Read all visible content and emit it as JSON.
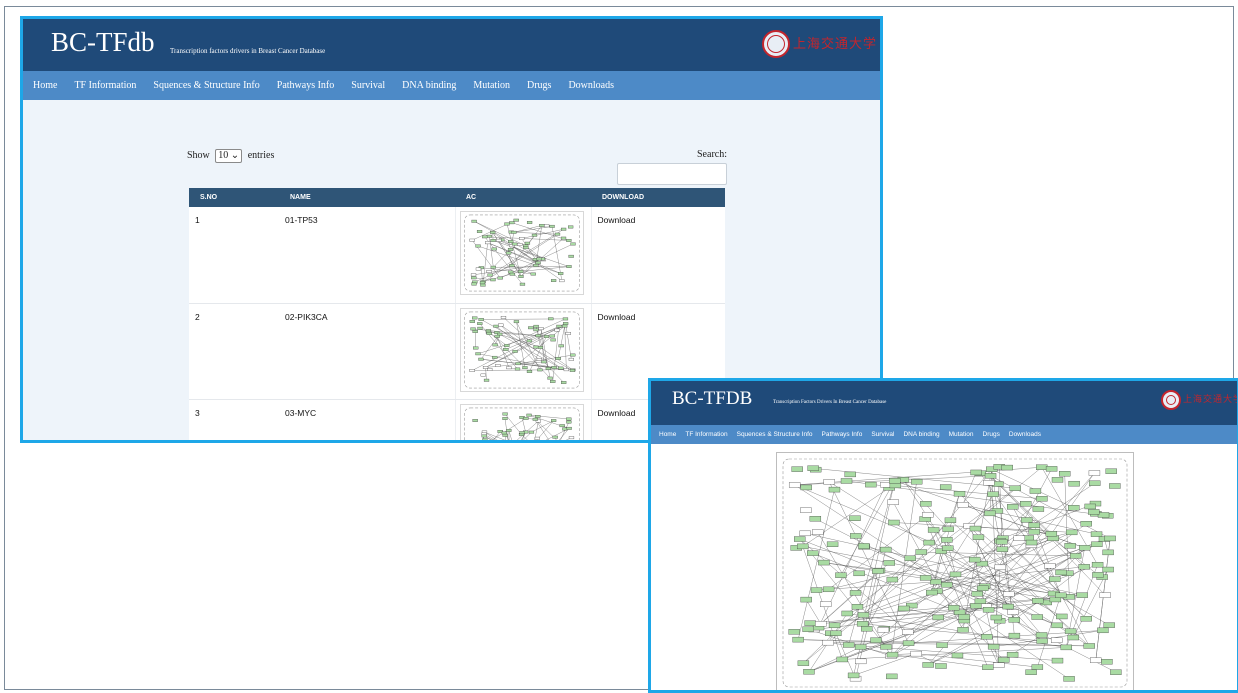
{
  "app": {
    "title": "BC-TFdb",
    "subtitle": "Transcription factors drivers in Breast Cancer Database",
    "logo_text": "上海交通大学",
    "logo_icon": "university-seal"
  },
  "nav": [
    "Home",
    "TF Information",
    "Squences & Structure Info",
    "Pathways Info",
    "Survival",
    "DNA binding",
    "Mutation",
    "Drugs",
    "Downloads"
  ],
  "table_controls": {
    "show_label": "Show",
    "entries_value": "10",
    "entries_label": "entries",
    "search_label": "Search:",
    "search_value": ""
  },
  "table": {
    "columns": [
      "S.NO",
      "NAME",
      "AC",
      "DOWNLOAD"
    ],
    "rows": [
      {
        "sno": "1",
        "name": "01-TP53",
        "download": "Download"
      },
      {
        "sno": "2",
        "name": "02-PIK3CA",
        "download": "Download"
      },
      {
        "sno": "3",
        "name": "03-MYC",
        "download": "Download"
      }
    ]
  },
  "popup": {
    "title": "BC-TFDB",
    "subtitle": "Transcription Factors Drivers In Breast Cancer Database",
    "logo_text": "上海交通大学",
    "nav": [
      "Home",
      "TF Information",
      "Squences & Structure Info",
      "Pathways Info",
      "Survival",
      "DNA binding",
      "Mutation",
      "Drugs",
      "Downloads"
    ]
  },
  "colors": {
    "header": "#1f4a79",
    "nav": "#4d8ac7",
    "frame_accent": "#1ea7e8",
    "table_header": "#2f5577",
    "pathway_node": "#a9dba3"
  }
}
